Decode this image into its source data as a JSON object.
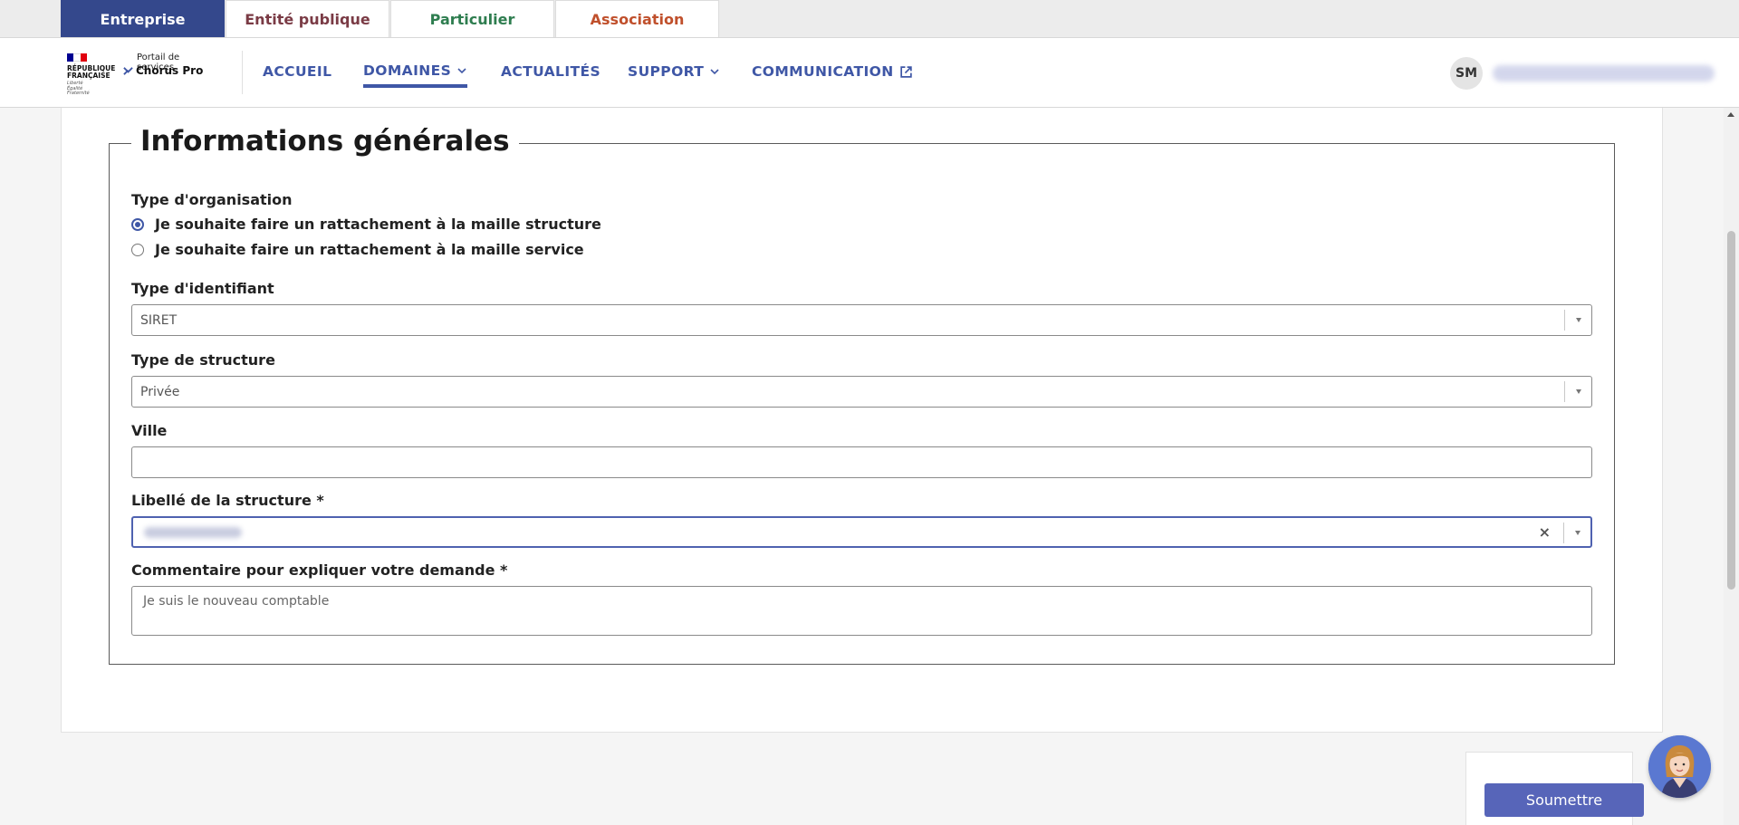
{
  "audience_tabs": [
    {
      "label": "Entreprise",
      "color": "#ffffff",
      "active": true
    },
    {
      "label": "Entité publique",
      "color": "#7a3b45",
      "active": false
    },
    {
      "label": "Particulier",
      "color": "#2e7d4f",
      "active": false
    },
    {
      "label": "Association",
      "color": "#c0502c",
      "active": false
    }
  ],
  "header": {
    "logo": {
      "republic_lines": [
        "RÉPUBLIQUE",
        "FRANÇAISE"
      ],
      "motto_lines": [
        "Liberté",
        "Égalité",
        "Fraternité"
      ],
      "portal_label": "Portail de services",
      "product_name": "Chorus Pro"
    },
    "nav": [
      {
        "label": "ACCUEIL",
        "icon": ""
      },
      {
        "label": "DOMAINES",
        "icon": "chevron-down-icon"
      },
      {
        "label": "ACTUALITÉS",
        "icon": ""
      },
      {
        "label": "SUPPORT",
        "icon": "chevron-down-icon"
      },
      {
        "label": "COMMUNICATION",
        "icon": "external-link-icon"
      }
    ],
    "active_nav": "DOMAINES",
    "user_initials": "SM"
  },
  "form": {
    "legend": "Informations générales",
    "org_type": {
      "label": "Type d'organisation",
      "options": [
        "Je souhaite faire un rattachement à la maille structure",
        "Je souhaite faire un rattachement à la maille service"
      ],
      "selected_index": 0
    },
    "identifier_type": {
      "label": "Type d'identifiant",
      "value": "SIRET"
    },
    "structure_type": {
      "label": "Type de structure",
      "value": "Privée"
    },
    "city": {
      "label": "Ville",
      "value": ""
    },
    "structure_label": {
      "label": "Libellé de la structure *",
      "clear_symbol": "×"
    },
    "comment": {
      "label": "Commentaire pour expliquer votre demande *",
      "value": "Je suis le nouveau comptable"
    }
  },
  "actions": {
    "submit_label": "Soumettre"
  },
  "colors": {
    "brand_blue": "#3f57a6",
    "button_blue": "#5765b9"
  }
}
